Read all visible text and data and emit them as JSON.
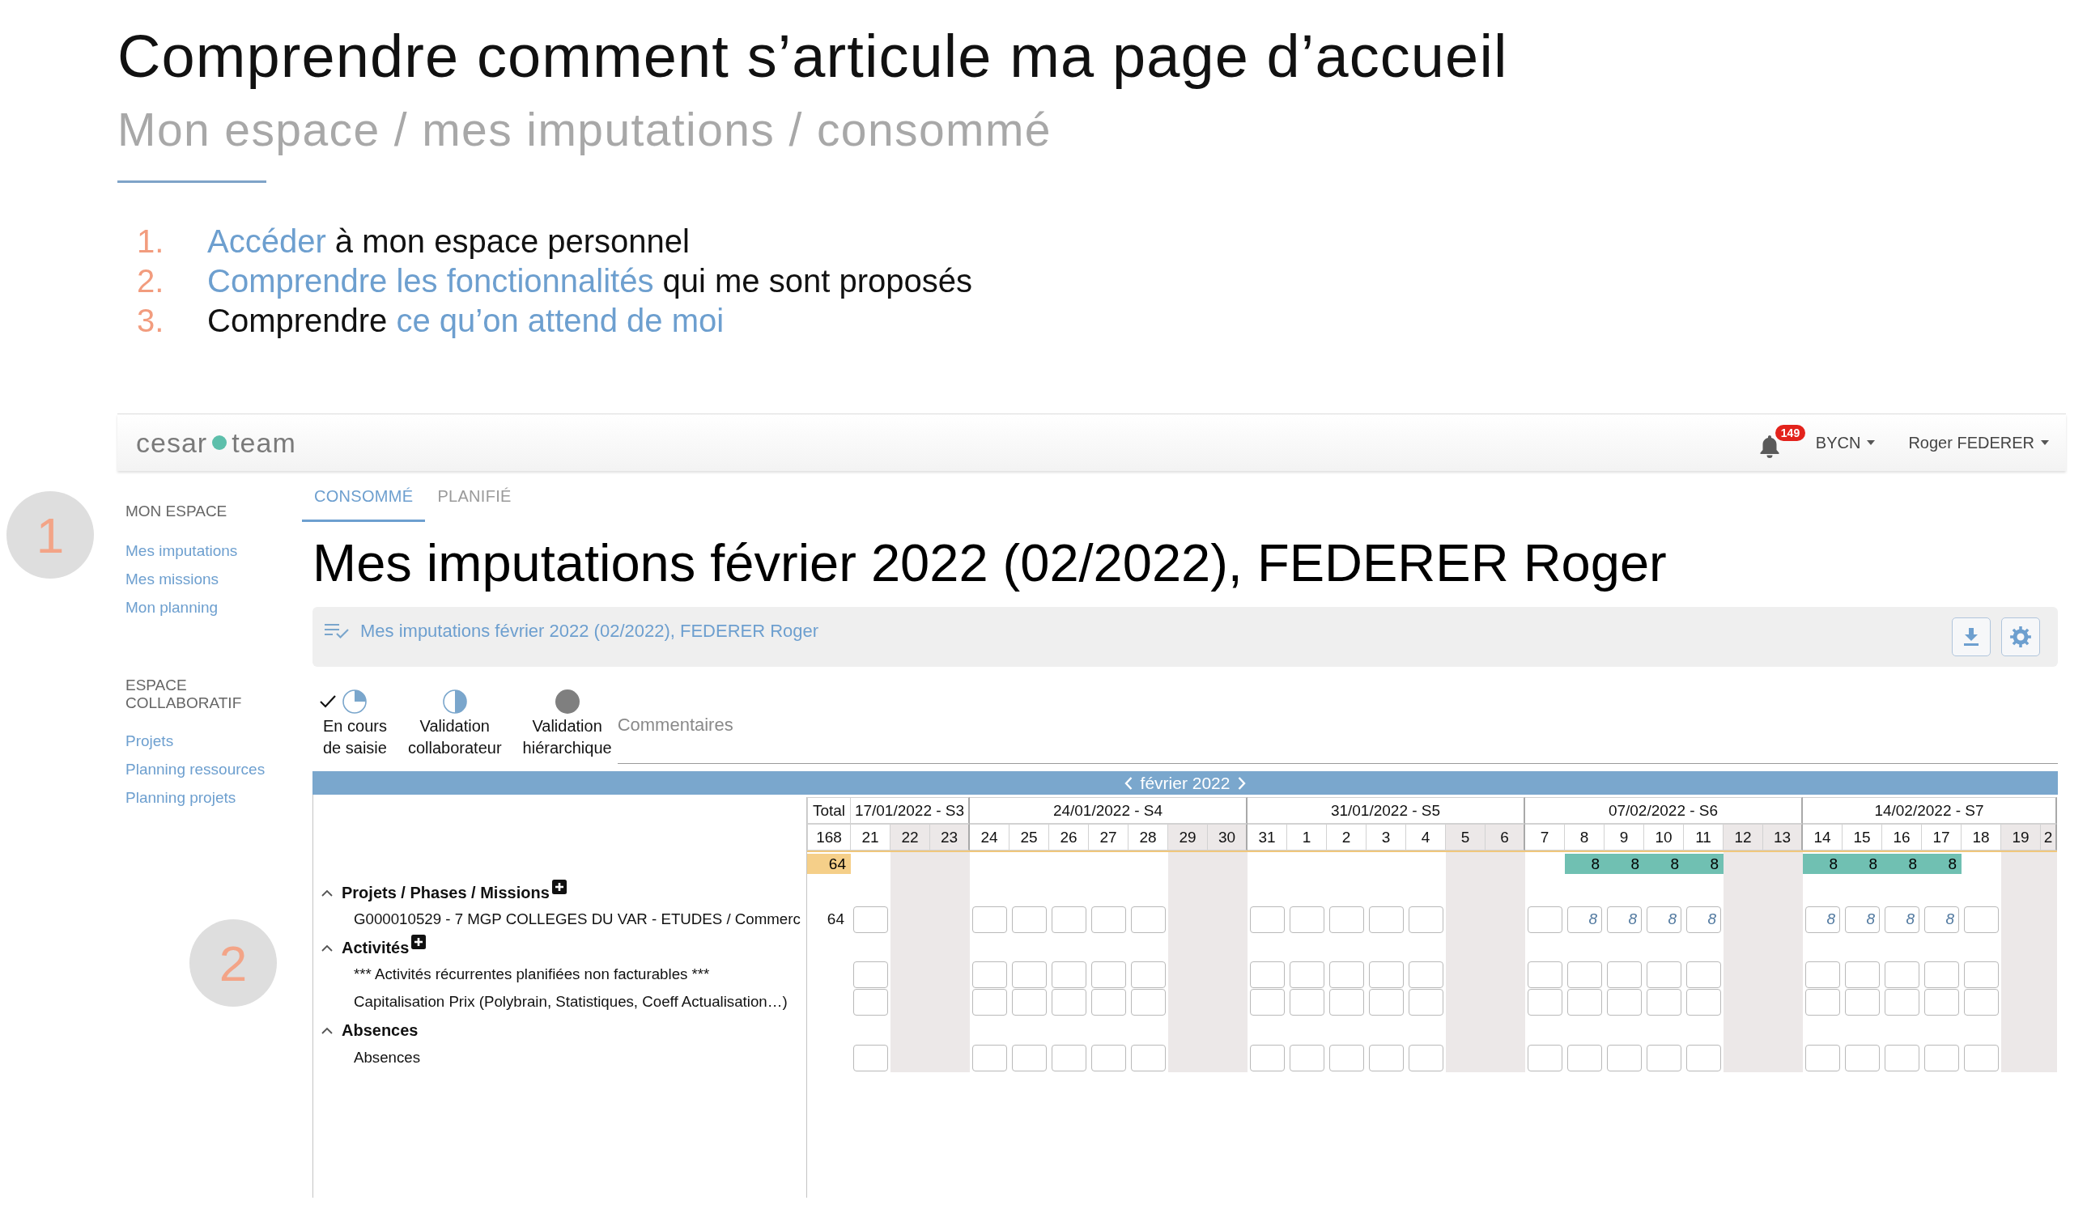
{
  "slide": {
    "title": "Comprendre comment s’articule ma page d’accueil",
    "subtitle": "Mon espace / mes imputations / consommé",
    "steps": [
      {
        "number": "1.",
        "parts": [
          {
            "text": "Accéder",
            "highlight": true
          },
          {
            "text": " à mon espace personnel",
            "highlight": false
          }
        ]
      },
      {
        "number": "2.",
        "parts": [
          {
            "text": "Comprendre les fonctionnalités",
            "highlight": true
          },
          {
            "text": " qui me sont proposés",
            "highlight": false
          }
        ]
      },
      {
        "number": "3.",
        "parts": [
          {
            "text": "Comprendre ",
            "highlight": false
          },
          {
            "text": "ce qu’on attend de moi",
            "highlight": true
          }
        ]
      }
    ],
    "markers": [
      "1",
      "2"
    ]
  },
  "app": {
    "logo": {
      "left": "cesar",
      "right": "team"
    },
    "notification_count": "149",
    "menus": [
      "BYCN",
      "Roger FEDERER"
    ],
    "sidebar": [
      {
        "title": "MON ESPACE",
        "items": [
          "Mes imputations",
          "Mes missions",
          "Mon planning"
        ]
      },
      {
        "title": "ESPACE COLLABORATIF",
        "items": [
          "Projets",
          "Planning ressources",
          "Planning projets"
        ]
      }
    ],
    "tabs": [
      {
        "label": "CONSOMMÉ",
        "selected": true
      },
      {
        "label": "PLANIFIÉ",
        "selected": false
      }
    ],
    "page_title": "Mes imputations février 2022 (02/2022), FEDERER Roger",
    "panel_title": "Mes imputations février 2022 (02/2022), FEDERER Roger",
    "statuses": [
      {
        "label": "En cours\nde saisie",
        "kind": "quarter",
        "current": true
      },
      {
        "label": "Validation\ncollaborateur",
        "kind": "half",
        "current": false
      },
      {
        "label": "Validation\nhiérarchique",
        "kind": "full",
        "current": false
      }
    ],
    "comments_heading": "Commentaires",
    "grid": {
      "month": "février 2022",
      "total_heading": "Total",
      "grand_total": "168",
      "period_total": "64",
      "weeks": [
        {
          "label": "17/01/2022 - S3",
          "days": [
            {
              "label": "21",
              "weekend": false
            },
            {
              "label": "22",
              "weekend": true
            },
            {
              "label": "23",
              "weekend": true
            }
          ]
        },
        {
          "label": "24/01/2022 - S4",
          "days": [
            {
              "label": "24",
              "weekend": false
            },
            {
              "label": "25",
              "weekend": false
            },
            {
              "label": "26",
              "weekend": false
            },
            {
              "label": "27",
              "weekend": false
            },
            {
              "label": "28",
              "weekend": false
            },
            {
              "label": "29",
              "weekend": true
            },
            {
              "label": "30",
              "weekend": true
            }
          ]
        },
        {
          "label": "31/01/2022 - S5",
          "days": [
            {
              "label": "31",
              "weekend": false
            },
            {
              "label": "1",
              "weekend": false
            },
            {
              "label": "2",
              "weekend": false
            },
            {
              "label": "3",
              "weekend": false
            },
            {
              "label": "4",
              "weekend": false
            },
            {
              "label": "5",
              "weekend": true
            },
            {
              "label": "6",
              "weekend": true
            }
          ]
        },
        {
          "label": "07/02/2022 - S6",
          "days": [
            {
              "label": "7",
              "weekend": false
            },
            {
              "label": "8",
              "weekend": false,
              "total": "8"
            },
            {
              "label": "9",
              "weekend": false,
              "total": "8"
            },
            {
              "label": "10",
              "weekend": false,
              "total": "8"
            },
            {
              "label": "11",
              "weekend": false,
              "total": "8"
            },
            {
              "label": "12",
              "weekend": true
            },
            {
              "label": "13",
              "weekend": true
            }
          ]
        },
        {
          "label": "14/02/2022 - S7",
          "days": [
            {
              "label": "14",
              "weekend": false,
              "total": "8"
            },
            {
              "label": "15",
              "weekend": false,
              "total": "8"
            },
            {
              "label": "16",
              "weekend": false,
              "total": "8"
            },
            {
              "label": "17",
              "weekend": false,
              "total": "8"
            },
            {
              "label": "18",
              "weekend": false
            },
            {
              "label": "19",
              "weekend": true
            },
            {
              "label": "2",
              "weekend": true
            }
          ]
        }
      ],
      "sections": [
        {
          "title": "Projets / Phases / Missions",
          "expanded": true,
          "add_button": true,
          "rows": [
            {
              "label": "G000010529 - 7 MGP COLLEGES DU VAR - ETUDES / Commerc",
              "total": "64",
              "cells": [
                {
                  "kind": "field"
                },
                {
                  "kind": "blank"
                },
                {
                  "kind": "blank"
                },
                {
                  "kind": "field"
                },
                {
                  "kind": "field"
                },
                {
                  "kind": "field"
                },
                {
                  "kind": "field"
                },
                {
                  "kind": "field"
                },
                {
                  "kind": "blank"
                },
                {
                  "kind": "blank"
                },
                {
                  "kind": "field"
                },
                {
                  "kind": "field"
                },
                {
                  "kind": "field"
                },
                {
                  "kind": "field"
                },
                {
                  "kind": "field"
                },
                {
                  "kind": "blank"
                },
                {
                  "kind": "blank"
                },
                {
                  "kind": "field"
                },
                {
                  "kind": "field",
                  "value": "8"
                },
                {
                  "kind": "field",
                  "value": "8"
                },
                {
                  "kind": "field",
                  "value": "8"
                },
                {
                  "kind": "field",
                  "value": "8"
                },
                {
                  "kind": "blank"
                },
                {
                  "kind": "blank"
                },
                {
                  "kind": "field",
                  "value": "8"
                },
                {
                  "kind": "field",
                  "value": "8"
                },
                {
                  "kind": "field",
                  "value": "8"
                },
                {
                  "kind": "field",
                  "value": "8"
                },
                {
                  "kind": "field"
                },
                {
                  "kind": "blank"
                },
                {
                  "kind": "blank"
                }
              ]
            }
          ]
        },
        {
          "title": "Activités",
          "expanded": true,
          "add_button": true,
          "rows": [
            {
              "label": "*** Activités récurrentes planifiées non facturables ***",
              "cells": [
                {
                  "kind": "field"
                },
                {
                  "kind": "blank"
                },
                {
                  "kind": "blank"
                },
                {
                  "kind": "field"
                },
                {
                  "kind": "field"
                },
                {
                  "kind": "field"
                },
                {
                  "kind": "field"
                },
                {
                  "kind": "field"
                },
                {
                  "kind": "blank"
                },
                {
                  "kind": "blank"
                },
                {
                  "kind": "field"
                },
                {
                  "kind": "field"
                },
                {
                  "kind": "field"
                },
                {
                  "kind": "field"
                },
                {
                  "kind": "field"
                },
                {
                  "kind": "blank"
                },
                {
                  "kind": "blank"
                },
                {
                  "kind": "field"
                },
                {
                  "kind": "field"
                },
                {
                  "kind": "field"
                },
                {
                  "kind": "field"
                },
                {
                  "kind": "field"
                },
                {
                  "kind": "blank"
                },
                {
                  "kind": "blank"
                },
                {
                  "kind": "field"
                },
                {
                  "kind": "field"
                },
                {
                  "kind": "field"
                },
                {
                  "kind": "field"
                },
                {
                  "kind": "field"
                },
                {
                  "kind": "blank"
                },
                {
                  "kind": "blank"
                }
              ]
            },
            {
              "label": "Capitalisation Prix (Polybrain, Statistiques, Coeff Actualisation…)",
              "cells": [
                {
                  "kind": "field"
                },
                {
                  "kind": "blank"
                },
                {
                  "kind": "blank"
                },
                {
                  "kind": "field"
                },
                {
                  "kind": "field"
                },
                {
                  "kind": "field"
                },
                {
                  "kind": "field"
                },
                {
                  "kind": "field"
                },
                {
                  "kind": "blank"
                },
                {
                  "kind": "blank"
                },
                {
                  "kind": "field"
                },
                {
                  "kind": "field"
                },
                {
                  "kind": "field"
                },
                {
                  "kind": "field"
                },
                {
                  "kind": "field"
                },
                {
                  "kind": "blank"
                },
                {
                  "kind": "blank"
                },
                {
                  "kind": "field"
                },
                {
                  "kind": "field"
                },
                {
                  "kind": "field"
                },
                {
                  "kind": "field"
                },
                {
                  "kind": "field"
                },
                {
                  "kind": "blank"
                },
                {
                  "kind": "blank"
                },
                {
                  "kind": "field"
                },
                {
                  "kind": "field"
                },
                {
                  "kind": "field"
                },
                {
                  "kind": "field"
                },
                {
                  "kind": "field"
                },
                {
                  "kind": "blank"
                },
                {
                  "kind": "blank"
                }
              ]
            }
          ]
        },
        {
          "title": "Absences",
          "expanded": true,
          "add_button": false,
          "rows": [
            {
              "label": "Absences",
              "cells": [
                {
                  "kind": "field"
                },
                {
                  "kind": "blank"
                },
                {
                  "kind": "blank"
                },
                {
                  "kind": "field"
                },
                {
                  "kind": "field"
                },
                {
                  "kind": "field"
                },
                {
                  "kind": "field"
                },
                {
                  "kind": "field"
                },
                {
                  "kind": "blank"
                },
                {
                  "kind": "blank"
                },
                {
                  "kind": "field"
                },
                {
                  "kind": "field"
                },
                {
                  "kind": "field"
                },
                {
                  "kind": "field"
                },
                {
                  "kind": "field"
                },
                {
                  "kind": "blank"
                },
                {
                  "kind": "blank"
                },
                {
                  "kind": "field"
                },
                {
                  "kind": "field"
                },
                {
                  "kind": "field"
                },
                {
                  "kind": "field"
                },
                {
                  "kind": "field"
                },
                {
                  "kind": "blank"
                },
                {
                  "kind": "blank"
                },
                {
                  "kind": "field"
                },
                {
                  "kind": "field"
                },
                {
                  "kind": "field"
                },
                {
                  "kind": "field"
                },
                {
                  "kind": "field"
                },
                {
                  "kind": "blank"
                },
                {
                  "kind": "blank"
                }
              ]
            }
          ]
        }
      ]
    }
  }
}
